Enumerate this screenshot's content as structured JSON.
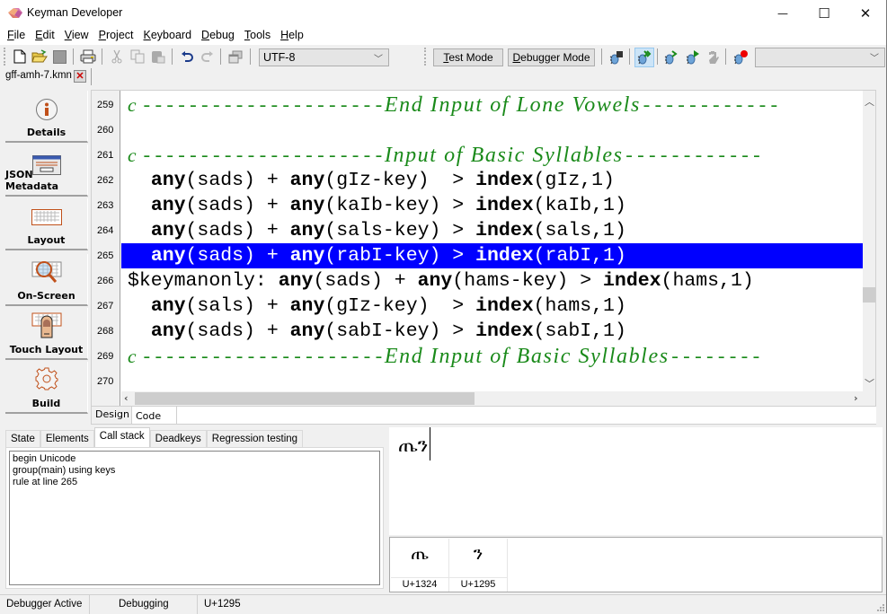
{
  "window": {
    "title": "Keyman Developer",
    "minimize_glyph": "—",
    "maximize_glyph": "☐",
    "close_glyph": "✕"
  },
  "menu": [
    {
      "label": "File",
      "accel": "F",
      "rest": "ile"
    },
    {
      "label": "Edit",
      "accel": "E",
      "rest": "dit"
    },
    {
      "label": "View",
      "accel": "V",
      "rest": "iew"
    },
    {
      "label": "Project",
      "accel": "P",
      "rest": "roject"
    },
    {
      "label": "Keyboard",
      "accel": "K",
      "rest": "eyboard"
    },
    {
      "label": "Debug",
      "accel": "D",
      "rest": "ebug"
    },
    {
      "label": "Tools",
      "accel": "T",
      "rest": "ools"
    },
    {
      "label": "Help",
      "accel": "H",
      "rest": "elp"
    }
  ],
  "toolbar": {
    "encoding_value": "UTF-8",
    "test_mode_label": "Test Mode",
    "debugger_mode_label": "Debugger Mode",
    "debug_dropdown_value": ""
  },
  "file_tab": {
    "name": "gff-amh-7.kmn",
    "close_glyph": "✕"
  },
  "sidebar": [
    {
      "label": "Details",
      "icon": "info-icon"
    },
    {
      "label": "JSON Metadata",
      "icon": "json-metadata-icon"
    },
    {
      "label": "Layout",
      "icon": "keyboard-icon"
    },
    {
      "label": "On-Screen",
      "icon": "on-screen-keyboard-icon"
    },
    {
      "label": "Touch Layout",
      "icon": "touch-layout-icon"
    },
    {
      "label": "Build",
      "icon": "gear-icon"
    }
  ],
  "editor": {
    "highlighted_line": 265,
    "lines": [
      {
        "num": "259",
        "type": "comment",
        "prefix": "c ",
        "dashes": "---------------------",
        "text": "End Input of Lone Vowels",
        "trail": "------------"
      },
      {
        "num": "260",
        "type": "blank"
      },
      {
        "num": "261",
        "type": "comment",
        "prefix": "c ",
        "dashes": "---------------------",
        "text": "Input of Basic Syllables",
        "trail": "------------"
      },
      {
        "num": "262",
        "type": "rule",
        "lead": "  ",
        "g1": "sads",
        "g2": "gIz-key",
        "sp": "  ",
        "out": "gIz,1",
        "pre": ""
      },
      {
        "num": "263",
        "type": "rule",
        "lead": "  ",
        "g1": "sads",
        "g2": "kaIb-key",
        "sp": " ",
        "out": "kaIb,1",
        "pre": ""
      },
      {
        "num": "264",
        "type": "rule",
        "lead": "  ",
        "g1": "sads",
        "g2": "sals-key",
        "sp": " ",
        "out": "sals,1",
        "pre": ""
      },
      {
        "num": "265",
        "type": "rule",
        "lead": "  ",
        "g1": "sads",
        "g2": "rabI-key",
        "sp": " ",
        "out": "rabI,1",
        "pre": ""
      },
      {
        "num": "266",
        "type": "rule",
        "lead": "",
        "g1": "sads",
        "g2": "hams-key",
        "sp": " ",
        "out": "hams,1",
        "pre": "$keymanonly: "
      },
      {
        "num": "267",
        "type": "rule",
        "lead": "  ",
        "g1": "sals",
        "g2": "gIz-key",
        "sp": "  ",
        "out": "hams,1",
        "pre": ""
      },
      {
        "num": "268",
        "type": "rule",
        "lead": "  ",
        "g1": "sads",
        "g2": "sabI-key",
        "sp": " ",
        "out": "sabI,1",
        "pre": ""
      },
      {
        "num": "269",
        "type": "comment",
        "prefix": "c ",
        "dashes": "---------------------",
        "text": "End Input of Basic Syllables",
        "trail": "--------"
      },
      {
        "num": "270",
        "type": "blank"
      }
    ],
    "keyword_any": "any",
    "keyword_index": "index",
    "plus": " + ",
    "gt": " > "
  },
  "editor_tabs": {
    "design_label": "Design",
    "code_label": "Code",
    "active": "Code"
  },
  "debug_tabs": [
    {
      "label": "State",
      "active": false
    },
    {
      "label": "Elements",
      "active": false
    },
    {
      "label": "Call stack",
      "active": true
    },
    {
      "label": "Deadkeys",
      "active": false
    },
    {
      "label": "Regression testing",
      "active": false
    }
  ],
  "call_stack": [
    "begin Unicode",
    "group(main) using keys",
    "rule at line 265"
  ],
  "output": {
    "text": "ጤን"
  },
  "characters": [
    {
      "glyph": "ጤ",
      "code": "U+1324"
    },
    {
      "glyph": "ን",
      "code": "U+1295"
    }
  ],
  "status": {
    "debugger": "Debugger Active",
    "mode": "Debugging",
    "char": "U+1295"
  },
  "colors": {
    "selection": "#0000ff",
    "comment": "#1a8a1a",
    "active_tool": "#cce4f7"
  }
}
